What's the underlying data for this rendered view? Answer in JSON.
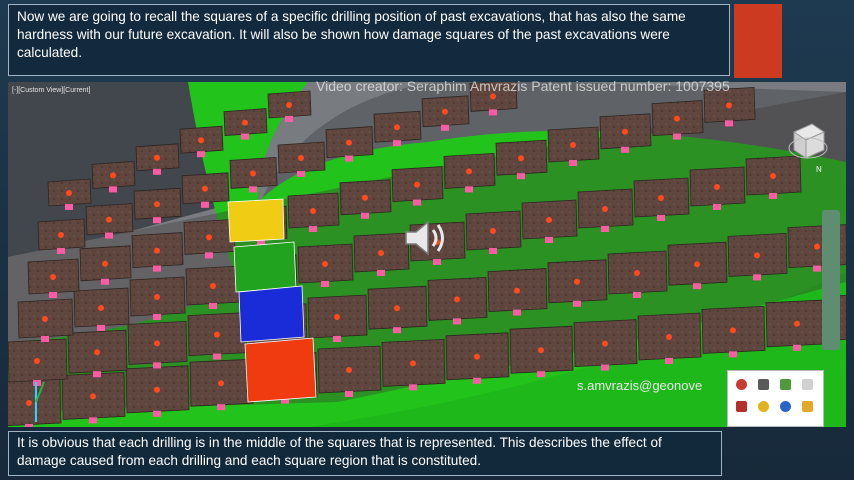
{
  "top_caption": "Now we are going to recall the squares of a specific drilling position of past excavations,  that has also the same hardness with our future excavation.  It will also be shown how damage squares of the past excavations were calculated.",
  "credit": "Video creator: Seraphim Amvrazis   Patent issued number: 1007395",
  "view_label": "[-][Custom View][Current]",
  "email": "s.amvrazis@geonove",
  "bottom_caption": "It is obvious that each drilling is in the middle of the squares that is represented. This describes the effect of damage caused from each drilling and each square region that is constituted.",
  "icons": {
    "speaker": "speaker-icon",
    "view_cube": "view-cube-icon",
    "tray": [
      "network-icon",
      "monitor-icon",
      "battery-icon",
      "volume-icon",
      "usb-icon",
      "chrome-icon",
      "bluetooth-icon",
      "folder-icon"
    ]
  },
  "colors": {
    "highlight_squares": [
      "#f0cd14",
      "#22a31f",
      "#1a2bd8",
      "#f03b10"
    ],
    "tile": "#5e463f",
    "ground": "#22c41c",
    "drill_marker": "#ff5aa5"
  }
}
